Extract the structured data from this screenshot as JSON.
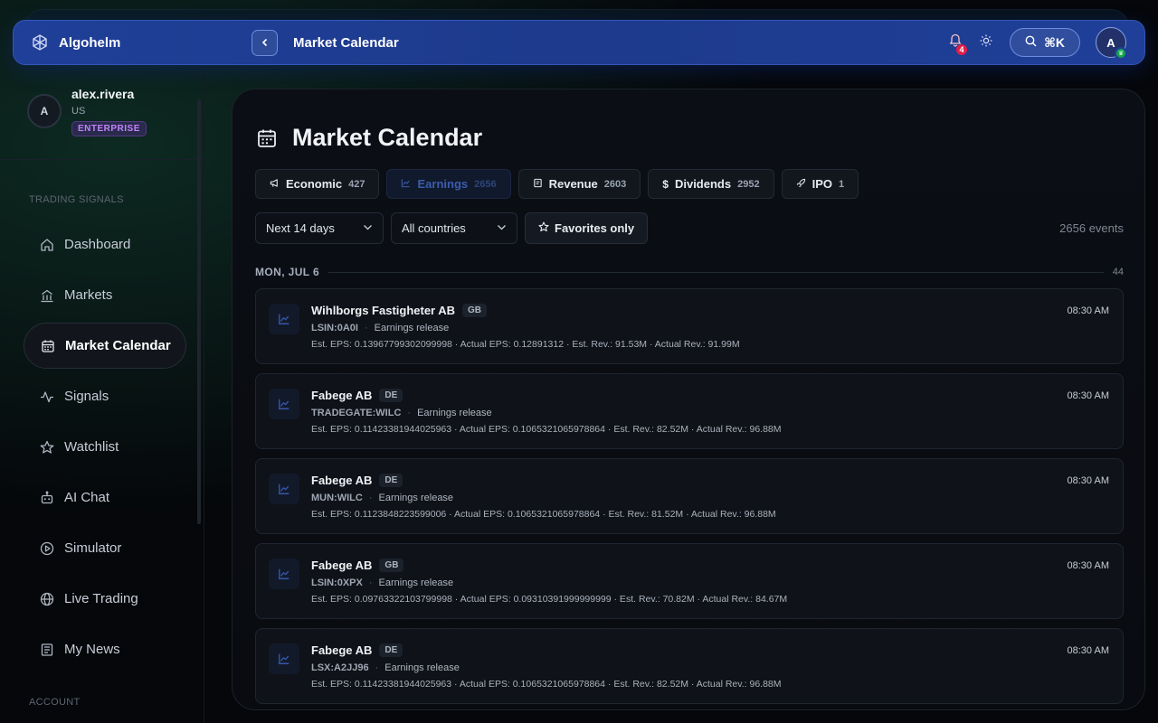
{
  "app": {
    "name": "Algohelm"
  },
  "topbar": {
    "title": "Market Calendar",
    "notifications": "4",
    "search_shortcut": "⌘K",
    "avatar_initial": "A"
  },
  "profile": {
    "initial": "A",
    "username": "alex.rivera",
    "country": "US",
    "plan": "ENTERPRISE"
  },
  "sidebar": {
    "section_trading": "TRADING SIGNALS",
    "section_account": "ACCOUNT",
    "items": [
      {
        "label": "Dashboard",
        "icon": "home-icon"
      },
      {
        "label": "Markets",
        "icon": "building-icon"
      },
      {
        "label": "Market Calendar",
        "icon": "calendar-icon",
        "active": true
      },
      {
        "label": "Signals",
        "icon": "pulse-icon"
      },
      {
        "label": "Watchlist",
        "icon": "star-icon"
      },
      {
        "label": "AI Chat",
        "icon": "bot-icon"
      },
      {
        "label": "Simulator",
        "icon": "play-circle-icon"
      },
      {
        "label": "Live Trading",
        "icon": "globe-icon"
      },
      {
        "label": "My News",
        "icon": "newspaper-icon"
      }
    ]
  },
  "page": {
    "title": "Market Calendar",
    "tabs": [
      {
        "label": "Economic",
        "count": "427",
        "icon": "megaphone-icon"
      },
      {
        "label": "Earnings",
        "count": "2656",
        "icon": "chart-line-icon",
        "active": true
      },
      {
        "label": "Revenue",
        "count": "2603",
        "icon": "receipt-icon"
      },
      {
        "label": "Dividends",
        "count": "2952",
        "icon": "dollar-icon"
      },
      {
        "label": "IPO",
        "count": "1",
        "icon": "rocket-icon"
      }
    ],
    "filters": {
      "range": "Next 14 days",
      "country": "All countries",
      "favorites": "Favorites only"
    },
    "event_count": "2656 events",
    "day": {
      "label": "MON, JUL 6",
      "count": "44"
    },
    "events": [
      {
        "name": "Wihlborgs Fastigheter AB",
        "country": "GB",
        "ticker": "LSIN:0A0I",
        "type": "Earnings release",
        "stats": "Est. EPS: 0.13967799302099998 · Actual EPS: 0.12891312 · Est. Rev.: 91.53M · Actual Rev.: 91.99M",
        "time": "08:30 AM"
      },
      {
        "name": "Fabege AB",
        "country": "DE",
        "ticker": "TRADEGATE:WILC",
        "type": "Earnings release",
        "stats": "Est. EPS: 0.11423381944025963 · Actual EPS: 0.1065321065978864 · Est. Rev.: 82.52M · Actual Rev.: 96.88M",
        "time": "08:30 AM"
      },
      {
        "name": "Fabege AB",
        "country": "DE",
        "ticker": "MUN:WILC",
        "type": "Earnings release",
        "stats": "Est. EPS: 0.1123848223599006 · Actual EPS: 0.1065321065978864 · Est. Rev.: 81.52M · Actual Rev.: 96.88M",
        "time": "08:30 AM"
      },
      {
        "name": "Fabege AB",
        "country": "GB",
        "ticker": "LSIN:0XPX",
        "type": "Earnings release",
        "stats": "Est. EPS: 0.09763322103799998 · Actual EPS: 0.09310391999999999 · Est. Rev.: 70.82M · Actual Rev.: 84.67M",
        "time": "08:30 AM"
      },
      {
        "name": "Fabege AB",
        "country": "DE",
        "ticker": "LSX:A2JJ96",
        "type": "Earnings release",
        "stats": "Est. EPS: 0.11423381944025963 · Actual EPS: 0.1065321065978864 · Est. Rev.: 82.52M · Actual Rev.: 96.88M",
        "time": "08:30 AM"
      }
    ]
  }
}
